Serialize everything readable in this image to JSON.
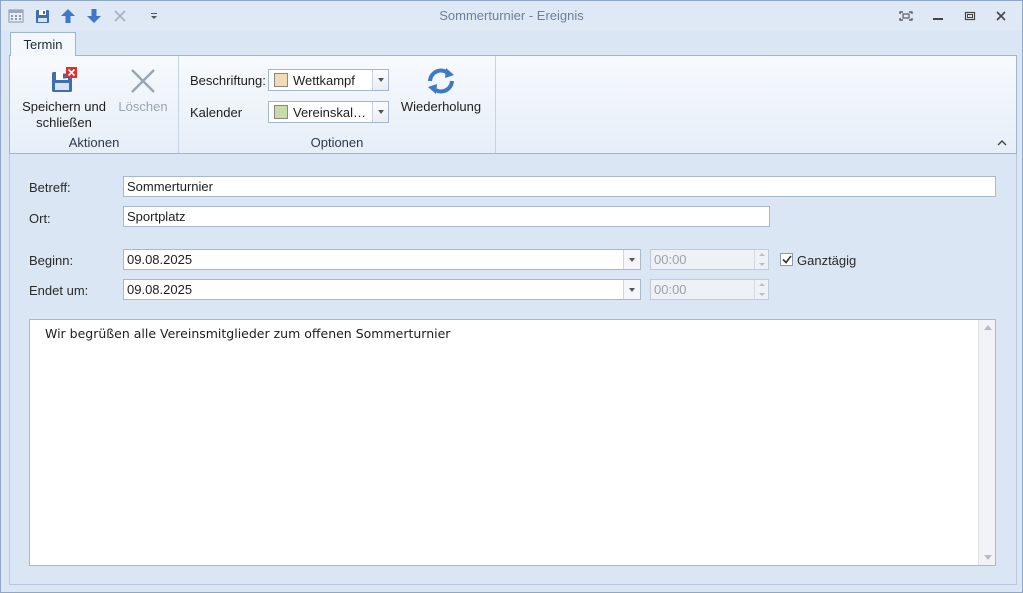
{
  "window": {
    "title": "Sommerturnier - Ereignis"
  },
  "quick_access": {
    "items": [
      "calendar-icon",
      "save-icon",
      "arrow-up-icon",
      "arrow-down-icon",
      "close-icon",
      "customize-icon"
    ]
  },
  "ribbon": {
    "tab": "Termin",
    "actions": {
      "save_close_line1": "Speichern und",
      "save_close_line2": "schließen",
      "delete": "Löschen",
      "group_label": "Aktionen"
    },
    "options": {
      "label_caption": "Beschriftung:",
      "label_value": "Wettkampf",
      "label_color": "#f0dcb6",
      "calendar_caption": "Kalender",
      "calendar_value": "Vereinskal…",
      "calendar_color": "#c9dba7",
      "recurrence": "Wiederholung",
      "group_label": "Optionen"
    }
  },
  "form": {
    "subject_label": "Betreff:",
    "subject_value": "Sommerturnier",
    "location_label": "Ort:",
    "location_value": "Sportplatz",
    "start_label": "Beginn:",
    "start_date": "09.08.2025",
    "start_time": "00:00",
    "end_label": "Endet um:",
    "end_date": "09.08.2025",
    "end_time": "00:00",
    "all_day_label": "Ganztägig",
    "all_day_checked": true,
    "notes": "Wir begrüßen alle Vereinsmitglieder zum offenen Sommerturnier"
  }
}
